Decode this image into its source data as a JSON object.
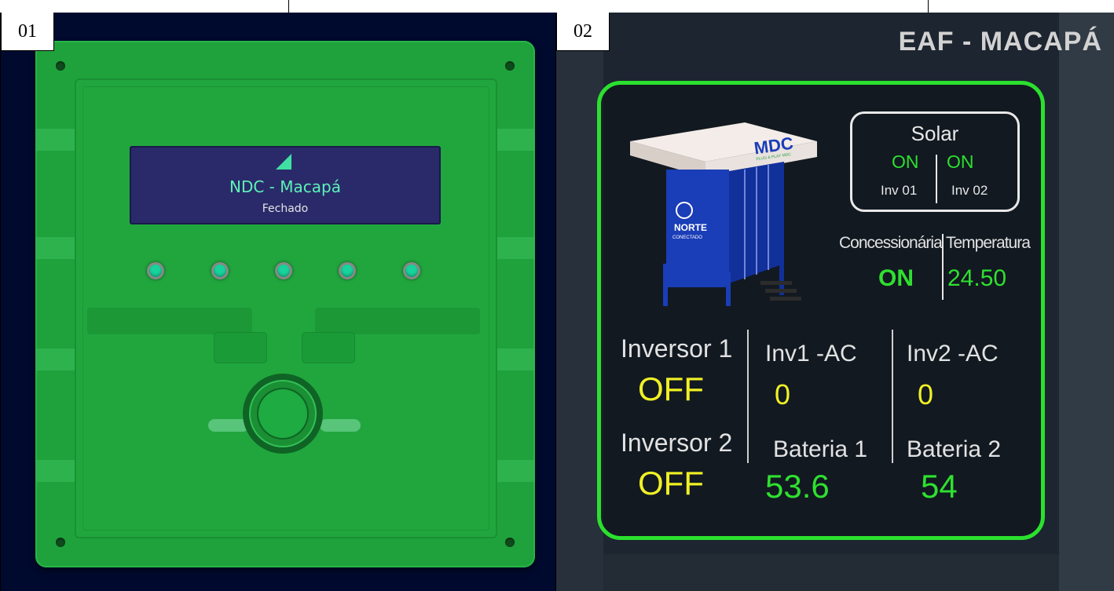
{
  "panel1": {
    "number": "01",
    "display": {
      "title": "NDC - Macapá",
      "status": "Fechado"
    },
    "led_color": "#18d39b",
    "device_color": "#1fa23b"
  },
  "panel2": {
    "number": "02",
    "site_title": "EAF - MACAPÁ",
    "logo": {
      "brand": "MDC",
      "tagline": "PLUG & PLAY MDC",
      "company": "NORTE",
      "company_sub": "CONECTADO"
    },
    "solar": {
      "title": "Solar",
      "inv01_status": "ON",
      "inv02_status": "ON",
      "inv01_label": "Inv 01",
      "inv02_label": "Inv 02"
    },
    "concessionaria": {
      "label": "Concessionária",
      "value": "ON"
    },
    "temperatura": {
      "label": "Temperatura",
      "value": "24.50"
    },
    "inversor1": {
      "label": "Inversor 1",
      "value": "OFF"
    },
    "inversor2": {
      "label": "Inversor 2",
      "value": "OFF"
    },
    "inv1_ac": {
      "label": "Inv1 -AC",
      "value": "0"
    },
    "inv2_ac": {
      "label": "Inv2 -AC",
      "value": "0"
    },
    "bateria1": {
      "label": "Bateria 1",
      "value": "53.6"
    },
    "bateria2": {
      "label": "Bateria 2",
      "value": "54"
    },
    "colors": {
      "frame": "#2be02e",
      "ok": "#2fe02f",
      "warn": "#f0f025",
      "text": "#e2e2e2"
    }
  }
}
